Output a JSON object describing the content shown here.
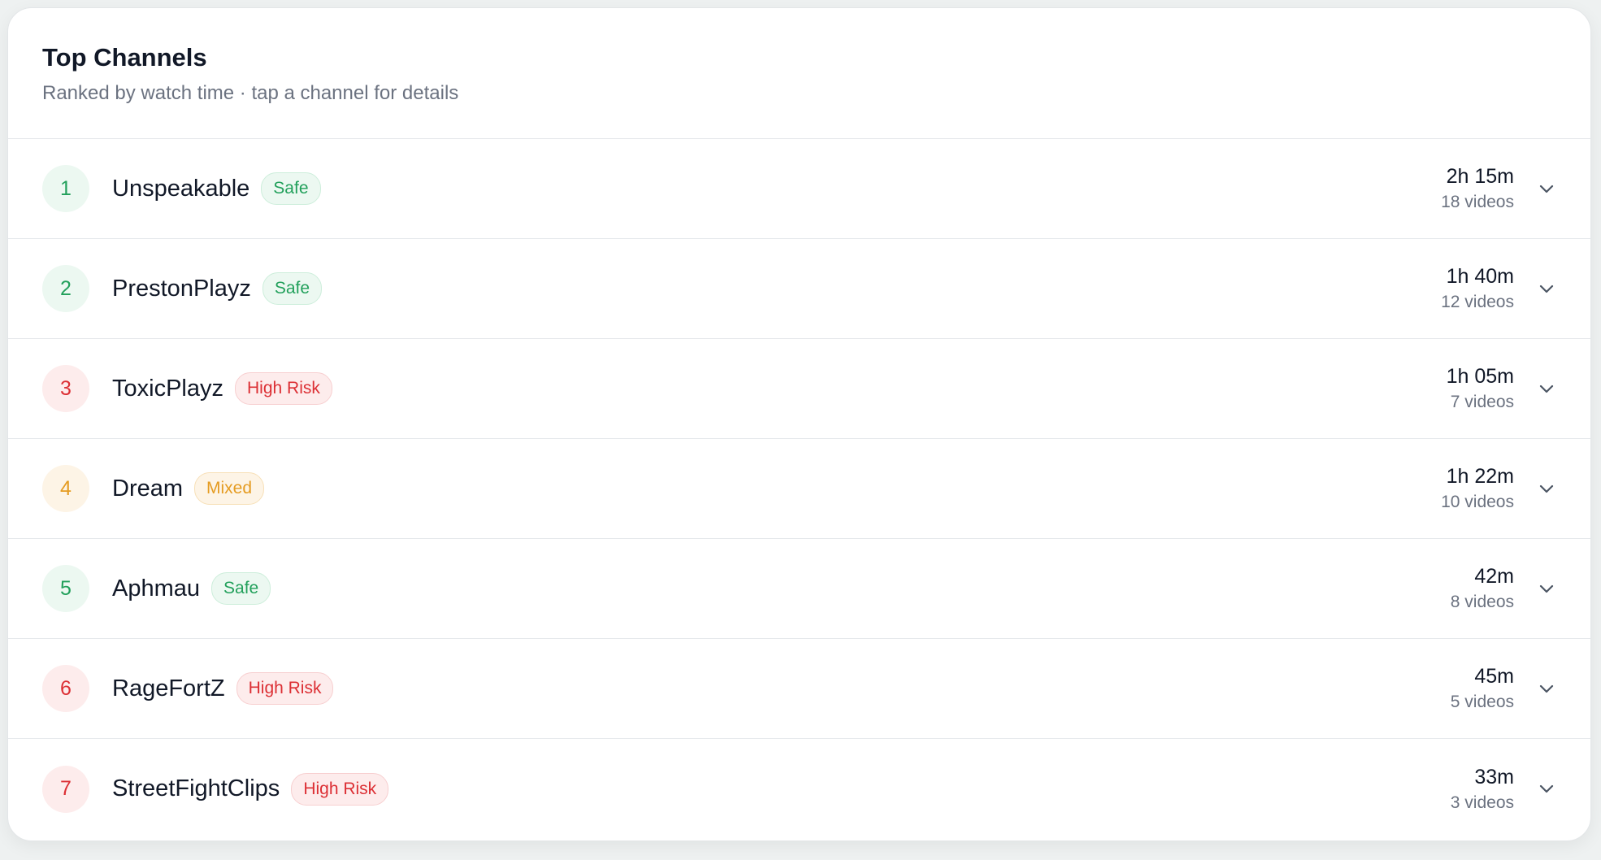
{
  "header": {
    "title": "Top Channels",
    "subtitle": "Ranked by watch time · tap a channel for details"
  },
  "colors": {
    "safe": {
      "text": "#22a05b",
      "bg": "#ecf8f1",
      "border": "#cdeedb"
    },
    "high_risk": {
      "text": "#dc2f34",
      "bg": "#fdecec",
      "border": "#f7cfd0"
    },
    "mixed": {
      "text": "#e59c22",
      "bg": "#fdf4e6",
      "border": "#f7e0b8"
    }
  },
  "channels": [
    {
      "rank": "1",
      "name": "Unspeakable",
      "risk": "safe",
      "badge": "Safe",
      "watch_time": "2h 15m",
      "videos": "18 videos",
      "icon": "chevron-down-icon"
    },
    {
      "rank": "2",
      "name": "PrestonPlayz",
      "risk": "safe",
      "badge": "Safe",
      "watch_time": "1h 40m",
      "videos": "12 videos",
      "icon": "chevron-down-icon"
    },
    {
      "rank": "3",
      "name": "ToxicPlayz",
      "risk": "high_risk",
      "badge": "High Risk",
      "watch_time": "1h 05m",
      "videos": "7 videos",
      "icon": "chevron-down-icon"
    },
    {
      "rank": "4",
      "name": "Dream",
      "risk": "mixed",
      "badge": "Mixed",
      "watch_time": "1h 22m",
      "videos": "10 videos",
      "icon": "chevron-down-icon"
    },
    {
      "rank": "5",
      "name": "Aphmau",
      "risk": "safe",
      "badge": "Safe",
      "watch_time": "42m",
      "videos": "8 videos",
      "icon": "chevron-down-icon"
    },
    {
      "rank": "6",
      "name": "RageFortZ",
      "risk": "high_risk",
      "badge": "High Risk",
      "watch_time": "45m",
      "videos": "5 videos",
      "icon": "chevron-down-icon"
    },
    {
      "rank": "7",
      "name": "StreetFightClips",
      "risk": "high_risk",
      "badge": "High Risk",
      "watch_time": "33m",
      "videos": "3 videos",
      "icon": "chevron-down-icon"
    }
  ]
}
